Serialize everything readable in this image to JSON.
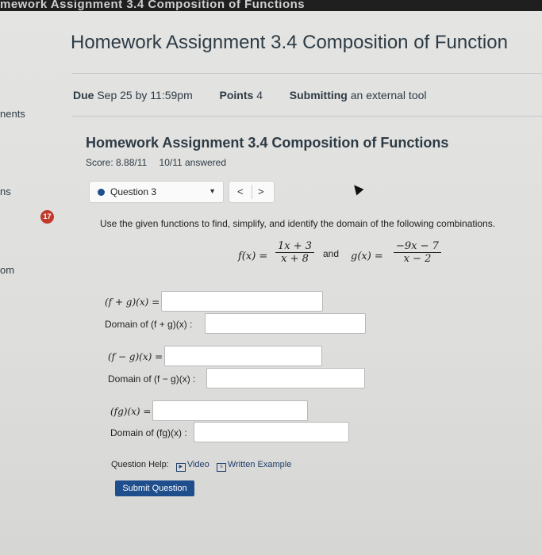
{
  "header": {
    "breadcrumb": "mework Assignment 3.4 Composition of Functions",
    "title": "Homework Assignment 3.4 Composition of Function"
  },
  "meta": {
    "due_label": "Due",
    "due_value": "Sep 25 by 11:59pm",
    "points_label": "Points",
    "points_value": "4",
    "submitting_label": "Submitting",
    "submitting_value": "an external tool"
  },
  "sidebar": {
    "item1": "nents",
    "item2": "ns",
    "item3": "om"
  },
  "assignment": {
    "title": "Homework Assignment 3.4 Composition of Functions",
    "score": "Score: 8.88/11",
    "answered": "10/11 answered"
  },
  "question_nav": {
    "selected": "Question 3",
    "prev": "<",
    "next": ">"
  },
  "question": {
    "number": "17",
    "prompt": "Use the given functions to find, simplify, and identify the domain of the following combinations.",
    "f_label": "f(x) =",
    "f_num": "1x + 3",
    "f_den": "x + 8",
    "and": "and",
    "g_label": "g(x) =",
    "g_num": "−9x − 7",
    "g_den": "x − 2",
    "sum_label": "(f + g)(x) =",
    "sum_domain_label": "Domain of (f + g)(x) :",
    "diff_label": "(f − g)(x) =",
    "diff_domain_label": "Domain of (f − g)(x) :",
    "prod_label": "(fg)(x) =",
    "prod_domain_label": "Domain of (fg)(x) :"
  },
  "help": {
    "label": "Question Help:",
    "video": "Video",
    "example": "Written Example"
  },
  "submit_label": "Submit Question",
  "colors": {
    "accent": "#1f4e8c",
    "badge": "#c0392b"
  }
}
